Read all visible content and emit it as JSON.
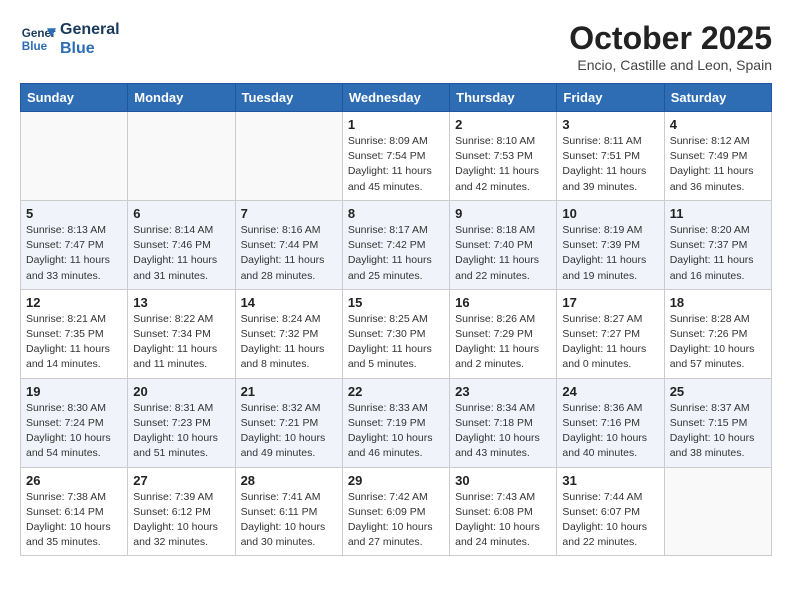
{
  "header": {
    "logo_line1": "General",
    "logo_line2": "Blue",
    "month_title": "October 2025",
    "subtitle": "Encio, Castille and Leon, Spain"
  },
  "weekdays": [
    "Sunday",
    "Monday",
    "Tuesday",
    "Wednesday",
    "Thursday",
    "Friday",
    "Saturday"
  ],
  "weeks": [
    [
      {
        "day": "",
        "info": ""
      },
      {
        "day": "",
        "info": ""
      },
      {
        "day": "",
        "info": ""
      },
      {
        "day": "1",
        "info": "Sunrise: 8:09 AM\nSunset: 7:54 PM\nDaylight: 11 hours\nand 45 minutes."
      },
      {
        "day": "2",
        "info": "Sunrise: 8:10 AM\nSunset: 7:53 PM\nDaylight: 11 hours\nand 42 minutes."
      },
      {
        "day": "3",
        "info": "Sunrise: 8:11 AM\nSunset: 7:51 PM\nDaylight: 11 hours\nand 39 minutes."
      },
      {
        "day": "4",
        "info": "Sunrise: 8:12 AM\nSunset: 7:49 PM\nDaylight: 11 hours\nand 36 minutes."
      }
    ],
    [
      {
        "day": "5",
        "info": "Sunrise: 8:13 AM\nSunset: 7:47 PM\nDaylight: 11 hours\nand 33 minutes."
      },
      {
        "day": "6",
        "info": "Sunrise: 8:14 AM\nSunset: 7:46 PM\nDaylight: 11 hours\nand 31 minutes."
      },
      {
        "day": "7",
        "info": "Sunrise: 8:16 AM\nSunset: 7:44 PM\nDaylight: 11 hours\nand 28 minutes."
      },
      {
        "day": "8",
        "info": "Sunrise: 8:17 AM\nSunset: 7:42 PM\nDaylight: 11 hours\nand 25 minutes."
      },
      {
        "day": "9",
        "info": "Sunrise: 8:18 AM\nSunset: 7:40 PM\nDaylight: 11 hours\nand 22 minutes."
      },
      {
        "day": "10",
        "info": "Sunrise: 8:19 AM\nSunset: 7:39 PM\nDaylight: 11 hours\nand 19 minutes."
      },
      {
        "day": "11",
        "info": "Sunrise: 8:20 AM\nSunset: 7:37 PM\nDaylight: 11 hours\nand 16 minutes."
      }
    ],
    [
      {
        "day": "12",
        "info": "Sunrise: 8:21 AM\nSunset: 7:35 PM\nDaylight: 11 hours\nand 14 minutes."
      },
      {
        "day": "13",
        "info": "Sunrise: 8:22 AM\nSunset: 7:34 PM\nDaylight: 11 hours\nand 11 minutes."
      },
      {
        "day": "14",
        "info": "Sunrise: 8:24 AM\nSunset: 7:32 PM\nDaylight: 11 hours\nand 8 minutes."
      },
      {
        "day": "15",
        "info": "Sunrise: 8:25 AM\nSunset: 7:30 PM\nDaylight: 11 hours\nand 5 minutes."
      },
      {
        "day": "16",
        "info": "Sunrise: 8:26 AM\nSunset: 7:29 PM\nDaylight: 11 hours\nand 2 minutes."
      },
      {
        "day": "17",
        "info": "Sunrise: 8:27 AM\nSunset: 7:27 PM\nDaylight: 11 hours\nand 0 minutes."
      },
      {
        "day": "18",
        "info": "Sunrise: 8:28 AM\nSunset: 7:26 PM\nDaylight: 10 hours\nand 57 minutes."
      }
    ],
    [
      {
        "day": "19",
        "info": "Sunrise: 8:30 AM\nSunset: 7:24 PM\nDaylight: 10 hours\nand 54 minutes."
      },
      {
        "day": "20",
        "info": "Sunrise: 8:31 AM\nSunset: 7:23 PM\nDaylight: 10 hours\nand 51 minutes."
      },
      {
        "day": "21",
        "info": "Sunrise: 8:32 AM\nSunset: 7:21 PM\nDaylight: 10 hours\nand 49 minutes."
      },
      {
        "day": "22",
        "info": "Sunrise: 8:33 AM\nSunset: 7:19 PM\nDaylight: 10 hours\nand 46 minutes."
      },
      {
        "day": "23",
        "info": "Sunrise: 8:34 AM\nSunset: 7:18 PM\nDaylight: 10 hours\nand 43 minutes."
      },
      {
        "day": "24",
        "info": "Sunrise: 8:36 AM\nSunset: 7:16 PM\nDaylight: 10 hours\nand 40 minutes."
      },
      {
        "day": "25",
        "info": "Sunrise: 8:37 AM\nSunset: 7:15 PM\nDaylight: 10 hours\nand 38 minutes."
      }
    ],
    [
      {
        "day": "26",
        "info": "Sunrise: 7:38 AM\nSunset: 6:14 PM\nDaylight: 10 hours\nand 35 minutes."
      },
      {
        "day": "27",
        "info": "Sunrise: 7:39 AM\nSunset: 6:12 PM\nDaylight: 10 hours\nand 32 minutes."
      },
      {
        "day": "28",
        "info": "Sunrise: 7:41 AM\nSunset: 6:11 PM\nDaylight: 10 hours\nand 30 minutes."
      },
      {
        "day": "29",
        "info": "Sunrise: 7:42 AM\nSunset: 6:09 PM\nDaylight: 10 hours\nand 27 minutes."
      },
      {
        "day": "30",
        "info": "Sunrise: 7:43 AM\nSunset: 6:08 PM\nDaylight: 10 hours\nand 24 minutes."
      },
      {
        "day": "31",
        "info": "Sunrise: 7:44 AM\nSunset: 6:07 PM\nDaylight: 10 hours\nand 22 minutes."
      },
      {
        "day": "",
        "info": ""
      }
    ]
  ]
}
